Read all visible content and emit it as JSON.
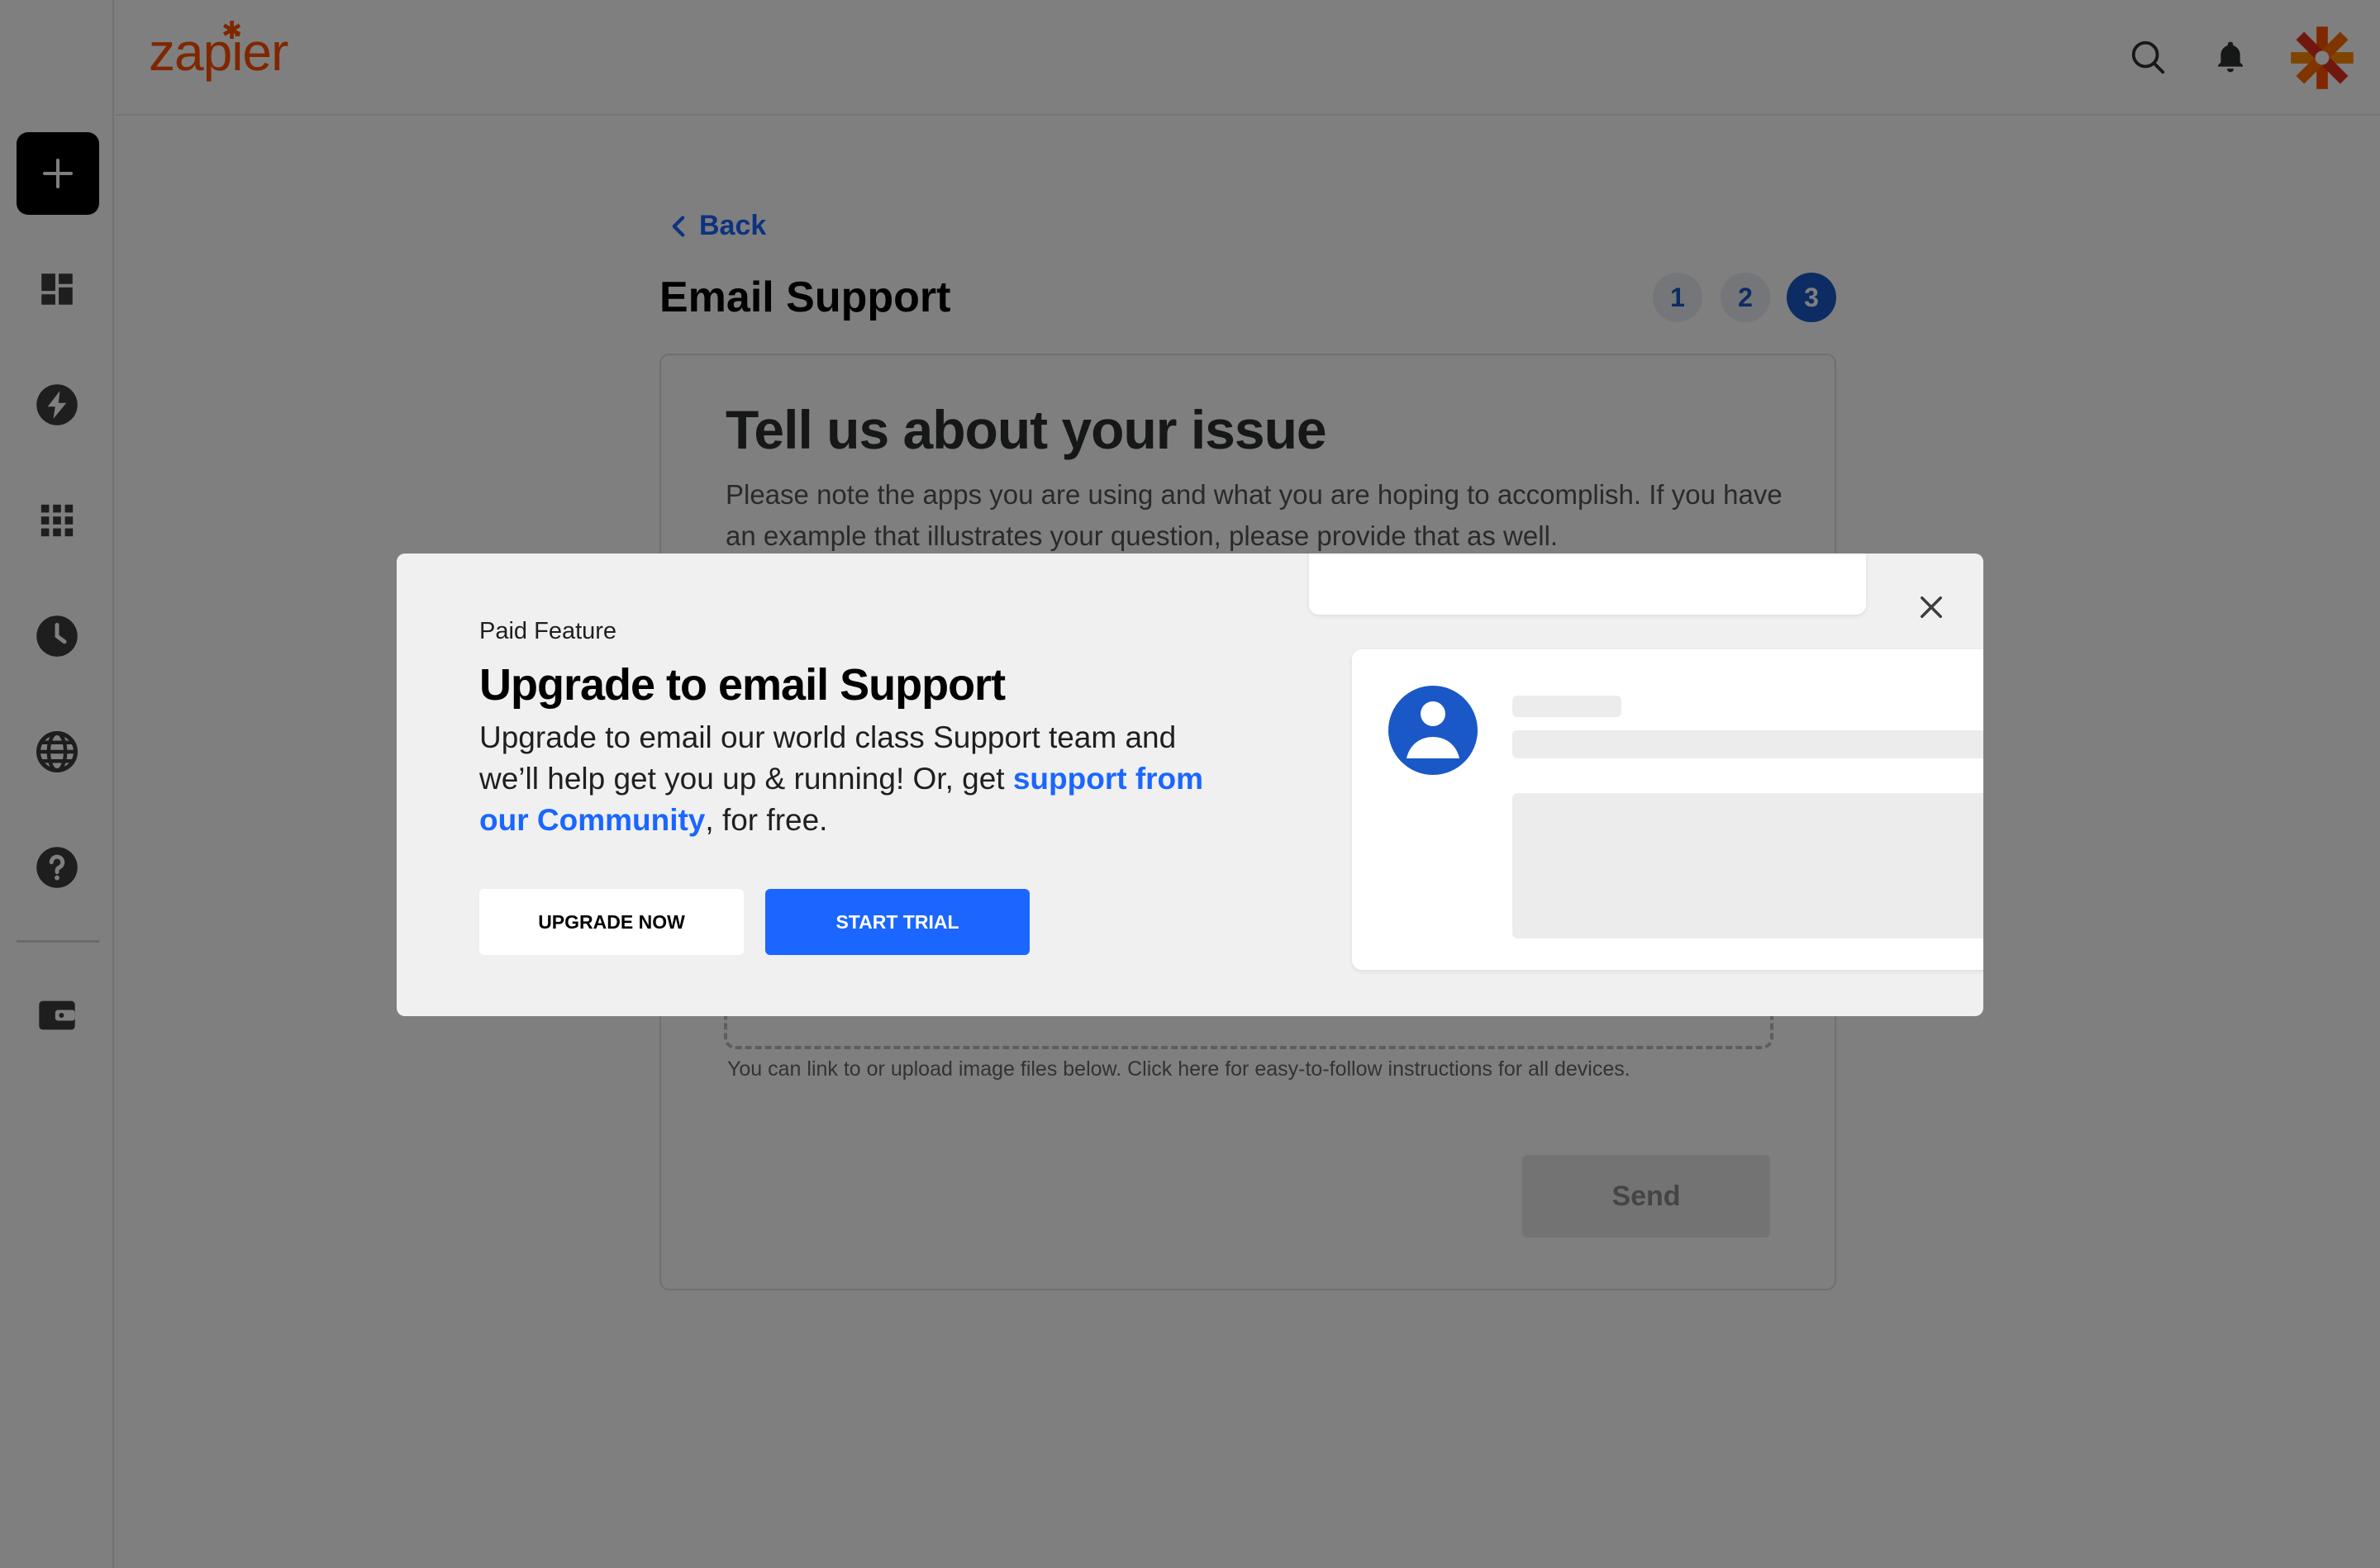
{
  "app": {
    "logo_text": "zapier",
    "brand_color": "#ff4f00",
    "accent_color": "#1a66ff"
  },
  "sidebar": {
    "create_icon": "plus-icon",
    "items": [
      {
        "name": "dashboard",
        "icon": "dashboard-icon"
      },
      {
        "name": "zaps",
        "icon": "bolt-icon"
      },
      {
        "name": "apps",
        "icon": "grid-icon"
      },
      {
        "name": "history",
        "icon": "clock-icon"
      },
      {
        "name": "explore",
        "icon": "globe-icon"
      },
      {
        "name": "help",
        "icon": "help-icon"
      },
      {
        "name": "billing",
        "icon": "wallet-icon"
      }
    ]
  },
  "header": {
    "search_icon": "search-icon",
    "notifications_icon": "bell-icon",
    "account_icon": "zapier-asterisk-icon"
  },
  "page": {
    "back_label": "Back",
    "title": "Email Support",
    "steps": [
      "1",
      "2",
      "3"
    ],
    "active_step": 3,
    "card": {
      "heading": "Tell us about your issue",
      "description": "Please note the apps you are using and what you are hoping to accomplish. If you have an example that illustrates your question, please provide that as well.",
      "hint": "You can link to or upload image files below. Click here for easy-to-follow instructions for all devices.",
      "send_label": "Send"
    }
  },
  "modal": {
    "eyebrow": "Paid Feature",
    "title": "Upgrade to email Support",
    "body_text": "Upgrade to email our world class Support team and we’ll help get you up & running! Or, get",
    "community_link": "support from our Community",
    "body_suffix": ", for free.",
    "upgrade_label": "UPGRADE NOW",
    "trial_label": "START TRIAL",
    "close_icon": "close-icon"
  }
}
